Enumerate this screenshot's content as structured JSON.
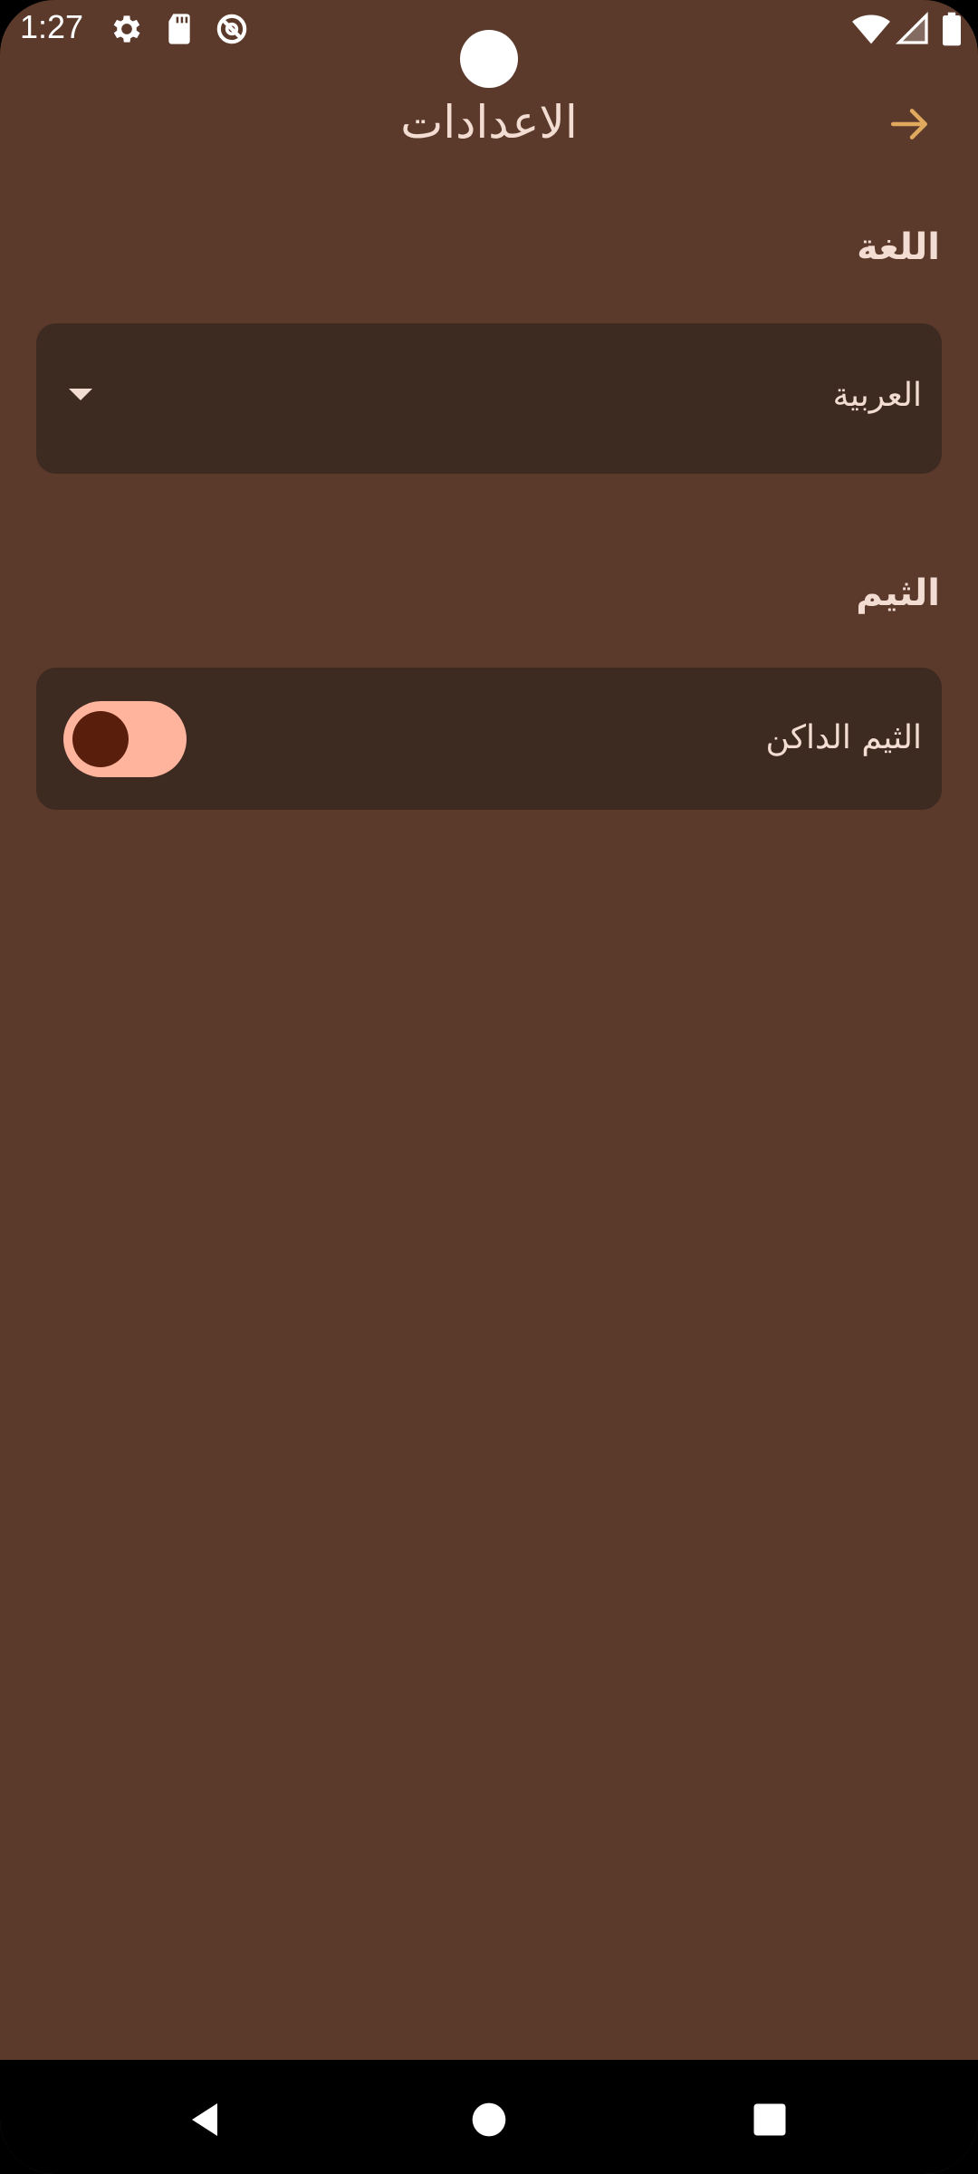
{
  "status_bar": {
    "time": "1:27",
    "icons": [
      "gear-icon",
      "sd-card-icon",
      "do-not-disturb-icon",
      "wifi-icon",
      "signal-icon",
      "battery-icon"
    ]
  },
  "header": {
    "title": "الاعدادات",
    "back_icon": "arrow-icon"
  },
  "language_section": {
    "title": "اللغة",
    "selected_value": "العربية"
  },
  "theme_section": {
    "title": "الثيم",
    "toggle_label": "الثيم الداكن",
    "toggle_on": true
  },
  "nav_bar": {
    "buttons": [
      "back-icon",
      "home-icon",
      "recents-icon"
    ]
  },
  "colors": {
    "background": "#5b3a2c",
    "card": "#3d2a21",
    "text": "#f3dcd2",
    "accent": "#e0a95d",
    "switch_track": "#ffb59d",
    "switch_thumb": "#5a1f0c"
  }
}
